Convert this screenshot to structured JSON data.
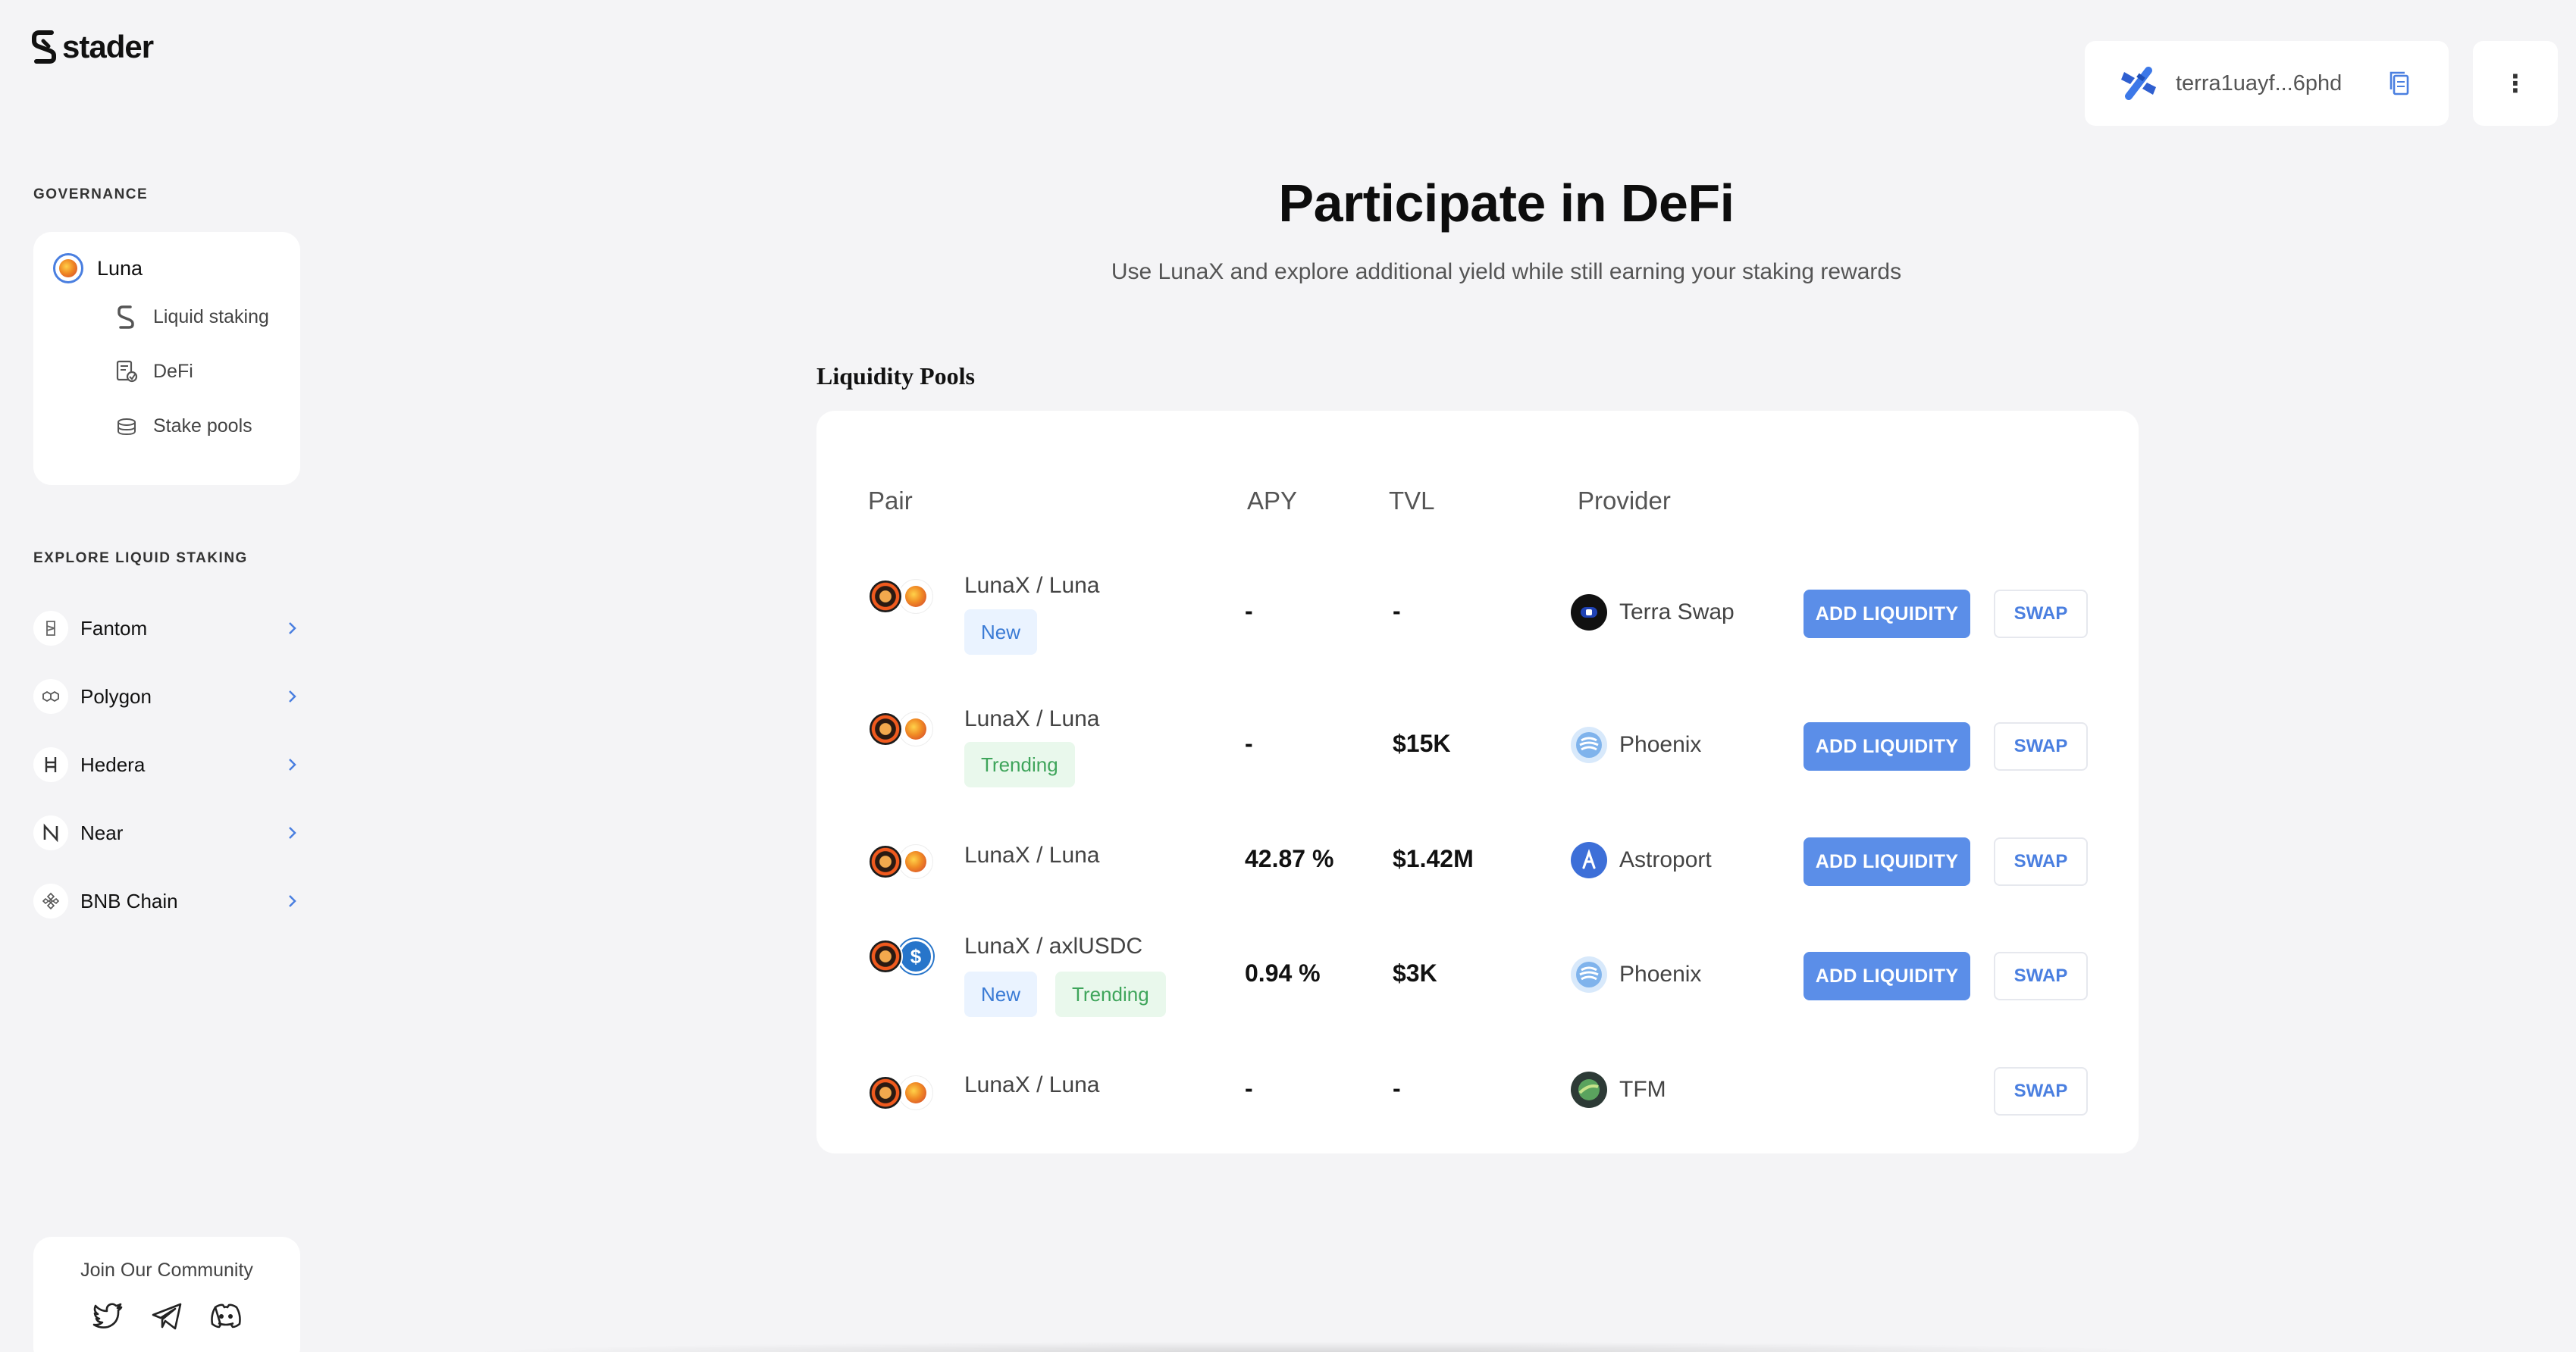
{
  "brand": {
    "logo_text": "stader"
  },
  "sidebar": {
    "governance_title": "GOVERNANCE",
    "governance": {
      "main": "Luna",
      "items": [
        {
          "label": "Liquid staking",
          "icon": "stader-s-icon"
        },
        {
          "label": "DeFi",
          "icon": "defi-icon"
        },
        {
          "label": "Stake pools",
          "icon": "coins-icon"
        }
      ]
    },
    "explore_title": "EXPLORE LIQUID STAKING",
    "explore": [
      {
        "label": "Fantom",
        "icon": "fantom-icon"
      },
      {
        "label": "Polygon",
        "icon": "polygon-icon"
      },
      {
        "label": "Hedera",
        "icon": "hedera-icon"
      },
      {
        "label": "Near",
        "icon": "near-icon"
      },
      {
        "label": "BNB Chain",
        "icon": "bnb-icon"
      }
    ],
    "community": {
      "label": "Join Our Community",
      "icons": [
        "twitter-icon",
        "telegram-icon",
        "discord-icon"
      ]
    }
  },
  "header": {
    "wallet_address": "terra1uayf...6phd",
    "menu_glyph": "⋮"
  },
  "hero": {
    "title": "Participate in DeFi",
    "subtitle": "Use LunaX and explore additional yield while still earning your staking rewards"
  },
  "pools": {
    "title": "Liquidity Pools",
    "columns": {
      "pair": "Pair",
      "apy": "APY",
      "tvl": "TVL",
      "provider": "Provider"
    },
    "add_label": "ADD LIQUIDITY",
    "swap_label": "SWAP",
    "rows": [
      {
        "pair": "LunaX / Luna",
        "tags": [
          "New"
        ],
        "apy": "-",
        "tvl": "-",
        "provider": "Terra Swap"
      },
      {
        "pair": "LunaX / Luna",
        "tags": [
          "Trending"
        ],
        "apy": "-",
        "tvl": "$15K",
        "provider": "Phoenix"
      },
      {
        "pair": "LunaX / Luna",
        "tags": [],
        "apy": "42.87 %",
        "tvl": "$1.42M",
        "provider": "Astroport"
      },
      {
        "pair": "LunaX / axlUSDC",
        "tags": [
          "New",
          "Trending"
        ],
        "apy": "0.94 %",
        "tvl": "$3K",
        "provider": "Phoenix"
      },
      {
        "pair": "LunaX / Luna",
        "tags": [],
        "apy": "-",
        "tvl": "-",
        "provider": "TFM"
      }
    ]
  },
  "colors": {
    "accent": "#5b8ee8",
    "background": "#f4f4f6",
    "new_tag": "#eaf3ff",
    "trending_tag": "#e9f8ec"
  }
}
